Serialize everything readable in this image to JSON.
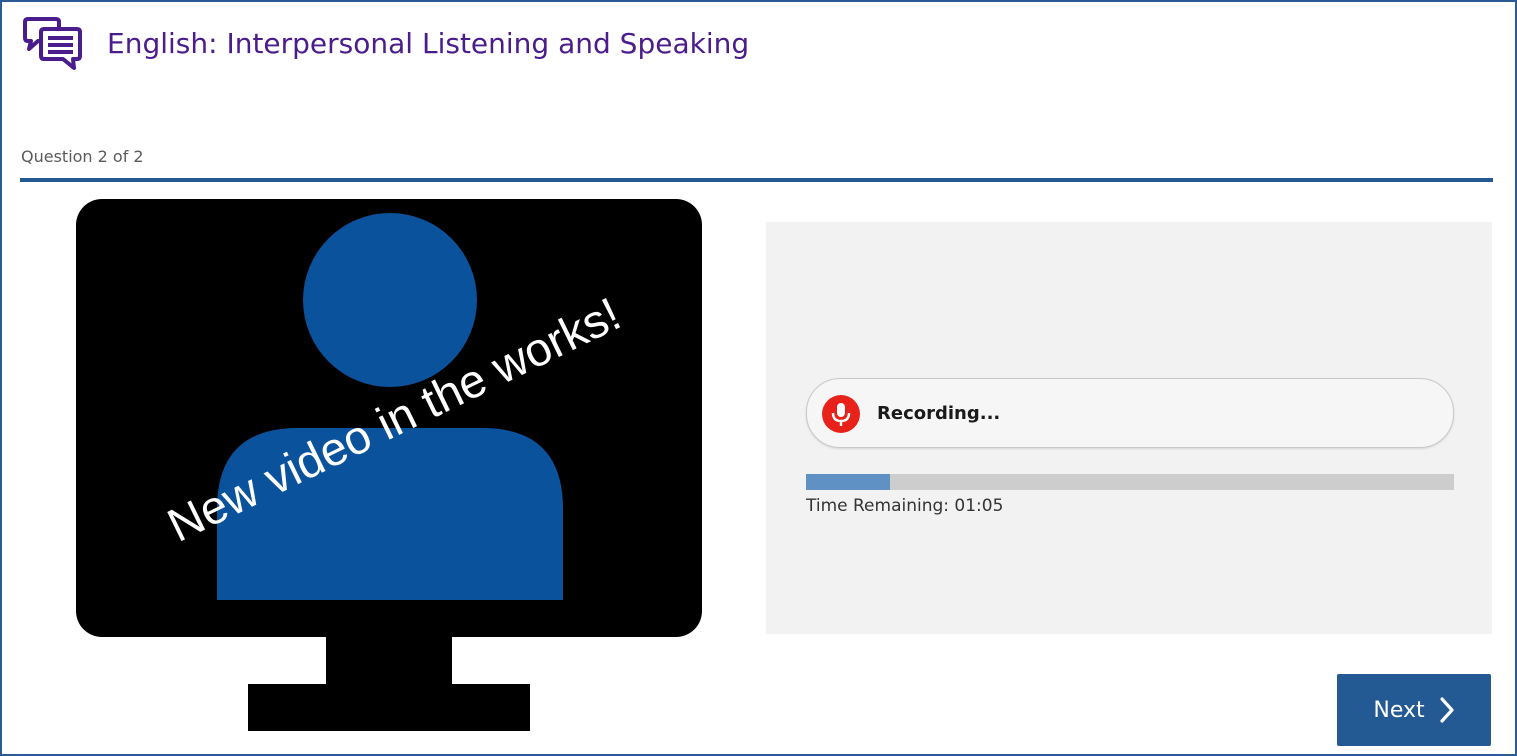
{
  "header": {
    "icon": "chat-bubbles-icon",
    "title": "English: Interpersonal Listening and Speaking"
  },
  "question": {
    "counter": "Question 2 of 2"
  },
  "video": {
    "placeholder_icon": "monitor-person-icon",
    "overlay_text": "New video in the works!"
  },
  "recorder": {
    "icon": "microphone-icon",
    "status": "Recording...",
    "progress_fraction": 0.13,
    "time_remaining_text": "Time Remaining: 01:05"
  },
  "navigation": {
    "next_label": "Next",
    "next_icon": "chevron-right-icon"
  },
  "colors": {
    "title": "#4a1c8c",
    "rule": "#245a93",
    "monitor": "#000000",
    "person": "#0a529b",
    "mic": "#e8221b",
    "progress_fill": "#5f91c5",
    "progress_track": "#cdcdcd",
    "button": "#245a93"
  }
}
